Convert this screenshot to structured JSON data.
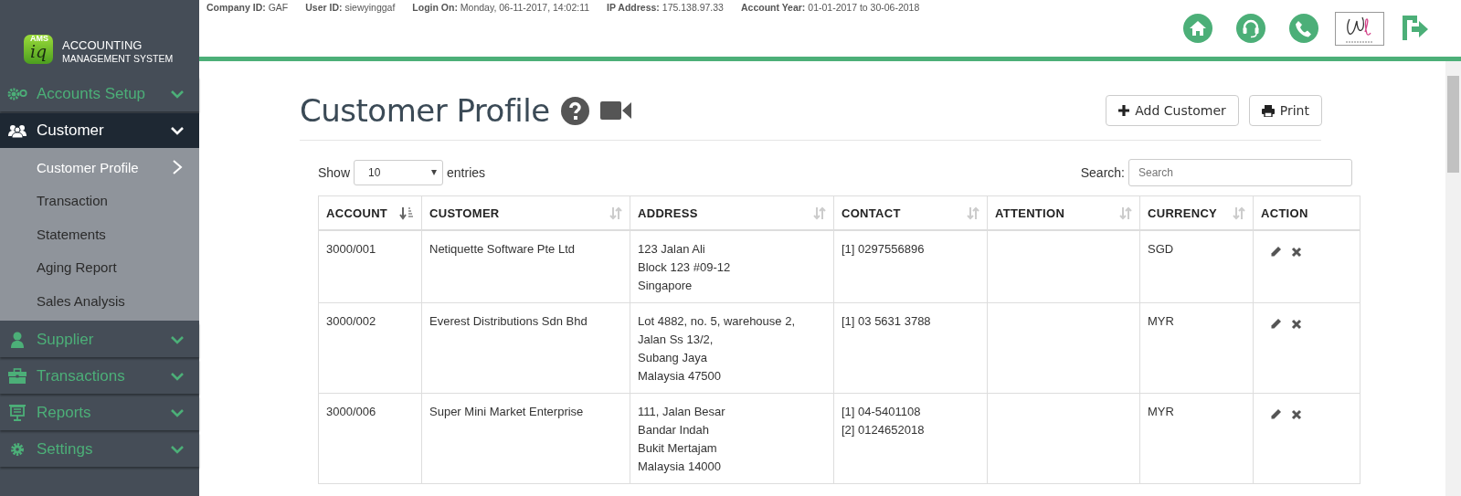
{
  "app": {
    "logo_badge": "AMS",
    "logo_mark": "iq",
    "title": "ACCOUNTING",
    "subtitle": "MANAGEMENT SYSTEM"
  },
  "session_info": [
    {
      "label": "Company ID:",
      "value": "GAF"
    },
    {
      "label": "User ID:",
      "value": "siewyinggaf"
    },
    {
      "label": "Login On:",
      "value": "Monday, 06-11-2017, 14:02:11"
    },
    {
      "label": "IP Address:",
      "value": "175.138.97.33"
    },
    {
      "label": "Account Year:",
      "value": "01-01-2017 to 30-06-2018"
    }
  ],
  "header_icons": [
    {
      "kind": "home"
    },
    {
      "kind": "headset"
    },
    {
      "kind": "phone"
    },
    {
      "kind": "company-logo"
    },
    {
      "kind": "logout"
    }
  ],
  "sidebar": {
    "items": [
      {
        "label": "Accounts Setup",
        "selected": false
      },
      {
        "label": "Customer",
        "selected": true,
        "children": [
          {
            "label": "Customer Profile",
            "selected": true
          },
          {
            "label": "Transaction",
            "selected": false
          },
          {
            "label": "Statements",
            "selected": false
          },
          {
            "label": "Aging Report",
            "selected": false
          },
          {
            "label": "Sales Analysis",
            "selected": false
          }
        ]
      },
      {
        "label": "Supplier",
        "selected": false
      },
      {
        "label": "Transactions",
        "selected": false
      },
      {
        "label": "Reports",
        "selected": false
      },
      {
        "label": "Settings",
        "selected": false
      }
    ]
  },
  "page": {
    "title": "Customer Profile",
    "buttons": [
      {
        "label": "Add Customer"
      },
      {
        "label": "Print"
      }
    ]
  },
  "table_controls": {
    "show_label": "Show",
    "page_size": "10",
    "entries_label": "entries",
    "search_label": "Search:",
    "search_placeholder": "Search"
  },
  "table": {
    "columns": [
      {
        "label": "ACCOUNT",
        "kind": "sorted"
      },
      {
        "label": "CUSTOMER",
        "kind": "sortable"
      },
      {
        "label": "ADDRESS",
        "kind": "sortable"
      },
      {
        "label": "CONTACT",
        "kind": "sortable"
      },
      {
        "label": "ATTENTION",
        "kind": "sortable"
      },
      {
        "label": "CURRENCY",
        "kind": "sortable"
      },
      {
        "label": "ACTION",
        "kind": "plain"
      }
    ],
    "rows": [
      {
        "account": "3000/001",
        "customer": "Netiquette Software Pte Ltd",
        "address": [
          "123 Jalan Ali",
          "Block 123 #09-12",
          "Singapore"
        ],
        "contact": [
          "[1] 0297556896"
        ],
        "currency": "SGD"
      },
      {
        "account": "3000/002",
        "customer": "Everest Distributions Sdn Bhd",
        "address": [
          "Lot 4882, no. 5, warehouse 2,",
          "Jalan Ss 13/2,",
          "Subang Jaya",
          "Malaysia 47500"
        ],
        "contact": [
          "[1] 03 5631 3788"
        ],
        "currency": "MYR"
      },
      {
        "account": "3000/006",
        "customer": "Super Mini Market Enterprise",
        "address": [
          "111, Jalan Besar",
          "Bandar Indah",
          "Bukit Mertajam",
          "Malaysia 14000"
        ],
        "contact": [
          "[1] 04-5401108",
          "[2] 0124652018"
        ],
        "currency": "MYR"
      }
    ]
  }
}
